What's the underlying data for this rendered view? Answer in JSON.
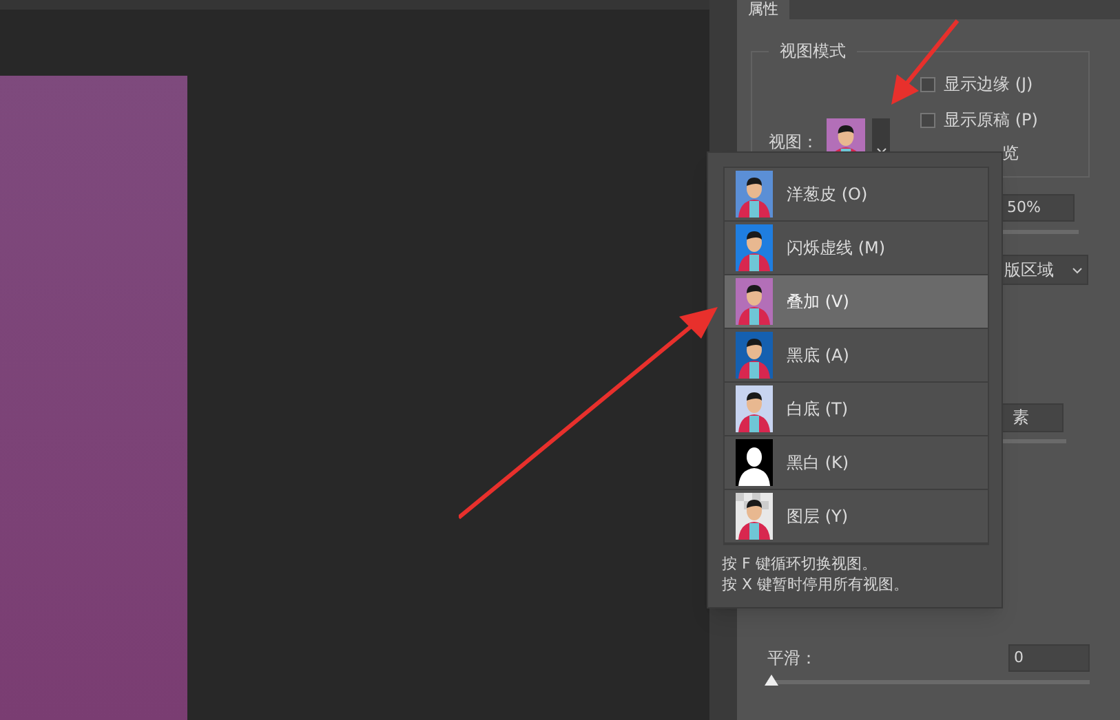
{
  "panel": {
    "tab": {
      "label": "属性",
      "selected": true
    },
    "view_mode": {
      "title": "视图模式",
      "view_label": "视图：",
      "checkboxes": [
        {
          "label": "显示边缘 (J)",
          "checked": false
        },
        {
          "label": "显示原稿 (P)",
          "checked": false
        }
      ],
      "partial_label": "览"
    },
    "opacity_field": {
      "value": "50%"
    },
    "mode_dropdown": {
      "value": "版区域"
    },
    "pixel_field": {
      "value": "素"
    },
    "smooth": {
      "label": "平滑：",
      "value": "0",
      "level": 0
    }
  },
  "view_menu": {
    "items": [
      {
        "label": "洋葱皮 (O)",
        "selected": false
      },
      {
        "label": "闪烁虚线 (M)",
        "selected": false
      },
      {
        "label": "叠加 (V)",
        "selected": true
      },
      {
        "label": "黑底 (A)",
        "selected": false
      },
      {
        "label": "白底 (T)",
        "selected": false
      },
      {
        "label": "黑白 (K)",
        "selected": false
      },
      {
        "label": "图层 (Y)",
        "selected": false
      }
    ],
    "hints": [
      "按 F 键循环切换视图。",
      "按 X 键暂时停用所有视图。"
    ]
  }
}
